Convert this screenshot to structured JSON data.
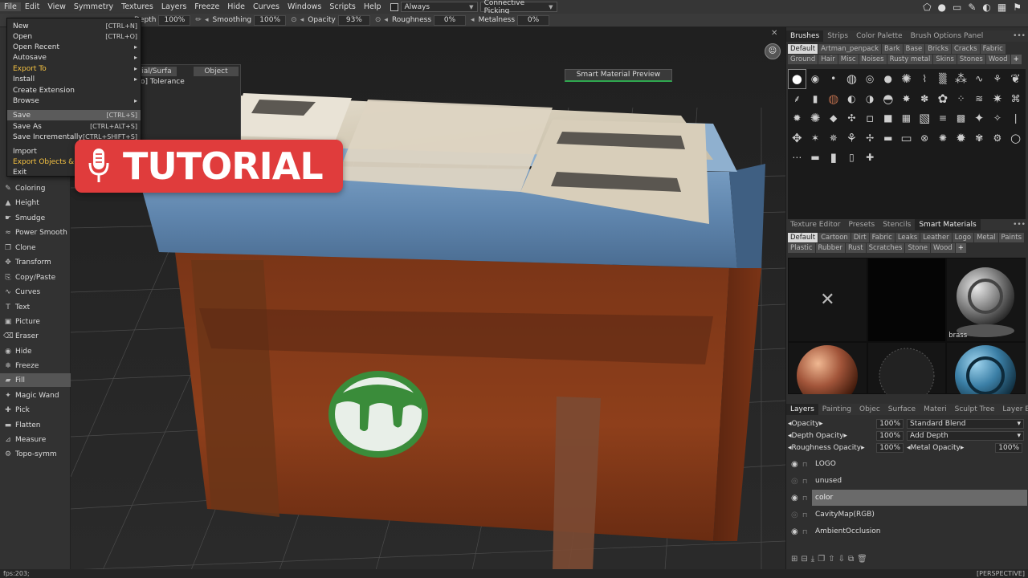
{
  "menubar": {
    "items": [
      "File",
      "Edit",
      "View",
      "Symmetry",
      "Textures",
      "Layers",
      "Freeze",
      "Hide",
      "Curves",
      "Windows",
      "Scripts",
      "Help"
    ],
    "always_label": "Always",
    "picking_value": "Connective Picking"
  },
  "toolbar": {
    "depth_label": "Depth",
    "depth_value": "100%",
    "smoothing_label": "Smoothing",
    "smoothing_value": "100%",
    "opacity_label": "Opacity",
    "opacity_value": "93%",
    "roughness_label": "Roughness",
    "roughness_value": "0%",
    "metalness_label": "Metalness",
    "metalness_value": "0%"
  },
  "file_menu": {
    "items": [
      {
        "label": "New",
        "shortcut": "[CTRL+N]"
      },
      {
        "label": "Open",
        "shortcut": "[CTRL+O]"
      },
      {
        "label": "Open Recent",
        "shortcut": "▸"
      },
      {
        "label": "Autosave",
        "shortcut": "▸"
      },
      {
        "label": "Export To",
        "shortcut": "▸"
      },
      {
        "label": "Install",
        "shortcut": "▸"
      },
      {
        "label": "Create Extension",
        "shortcut": ""
      },
      {
        "label": "Browse",
        "shortcut": "▸"
      },
      {
        "label": "Save",
        "shortcut": "[CTRL+S]"
      },
      {
        "label": "Save As",
        "shortcut": "[CTRL+ALT+S]"
      },
      {
        "label": "Save Incrementally",
        "shortcut": "[CTRL+SHIFT+S]"
      },
      {
        "label": "Import",
        "shortcut": ""
      },
      {
        "label": "Export Objects &",
        "shortcut": ""
      },
      {
        "label": "Exit",
        "shortcut": ""
      }
    ]
  },
  "float_panel": {
    "tab1": "erial/Surfa",
    "tab2": "Object",
    "tolerance_label": "o] Tolerance"
  },
  "tools": [
    "Coloring",
    "Height",
    "Smudge",
    "Power Smooth",
    "Clone",
    "Transform",
    "Copy/Paste",
    "Curves",
    "Text",
    "Picture",
    "Eraser",
    "Hide",
    "Freeze",
    "Fill",
    "Magic Wand",
    "Pick",
    "Flatten",
    "Measure",
    "Topo-symm"
  ],
  "tutorial_badge": "TUTORIAL",
  "viewport": {
    "smart_material_preview": "Smart Material Preview",
    "status_left": "fps:203;",
    "status_right": "[PERSPECTIVE]"
  },
  "brushes_panel": {
    "tabs": [
      "Brushes",
      "Strips",
      "Color Palette",
      "Brush Options Panel"
    ],
    "categories": [
      "Default",
      "Artman_penpack",
      "Bark",
      "Base",
      "Bricks",
      "Cracks",
      "Fabric",
      "Ground",
      "Hair",
      "Misc",
      "Noises",
      "Rusty metal",
      "Skins",
      "Stones",
      "Wood",
      "+"
    ]
  },
  "materials_panel": {
    "tabs": [
      "Texture Editor",
      "Presets",
      "Stencils",
      "Smart Materials"
    ],
    "categories": [
      "Default",
      "Cartoon",
      "Dirt",
      "Fabric",
      "Leaks",
      "Leather",
      "Logo",
      "Metal",
      "Paints",
      "Plastic",
      "Rubber",
      "Rust",
      "Scratches",
      "Stone",
      "Wood",
      "+"
    ],
    "materials": [
      {
        "label": ""
      },
      {
        "label": ""
      },
      {
        "label": "brass"
      },
      {
        "label": ""
      },
      {
        "label": ""
      },
      {
        "label": ""
      }
    ]
  },
  "layers_panel": {
    "tabs": [
      "Layers",
      "Painting",
      "Objec",
      "Surface",
      "Materi",
      "Sculpt Tree",
      "Layer Blending"
    ],
    "opacity_label": "Opacity",
    "opacity_value": "100%",
    "blend_value": "Standard Blend",
    "depth_opacity_label": "Depth Opacity",
    "depth_opacity_value": "100%",
    "depth_mode": "Add Depth",
    "roughness_opacity_label": "Roughness Opacity",
    "roughness_opacity_value": "100%",
    "metal_opacity_label": "Metal Opacity",
    "metal_opacity_value": "100%",
    "layers": [
      {
        "name": "LOGO",
        "visible": true
      },
      {
        "name": "unused",
        "visible": false
      },
      {
        "name": "color",
        "visible": true,
        "selected": true
      },
      {
        "name": "CavityMap(RGB)",
        "visible": false
      },
      {
        "name": "AmbientOcclusion",
        "visible": true
      }
    ]
  },
  "colors": {
    "accent_red": "#e03c3c",
    "gold_text": "#f5c242",
    "preview_green": "#2fa84f"
  }
}
